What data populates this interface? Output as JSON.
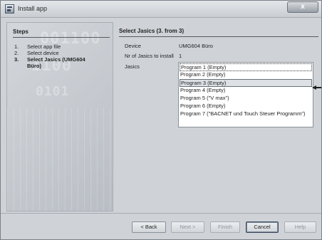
{
  "window": {
    "title": "Install app",
    "close_symbol": "x"
  },
  "steps": {
    "heading": "Steps",
    "items": [
      {
        "num": "1.",
        "label": "Select app file"
      },
      {
        "num": "2.",
        "label": "Select device"
      },
      {
        "num": "3.",
        "label": "Select Jasics (UMG604",
        "label2": "Büro)"
      }
    ]
  },
  "main": {
    "heading": "Select Jasics (3. from 3)",
    "fields": {
      "device_label": "Device",
      "device_value": "UMG604 Büro",
      "count_label": "Nr of Jasics to install",
      "count_value": "1",
      "jasics_label": "Jasics"
    },
    "jasics": [
      "Program 1 (Empty)",
      "Program 2 (Empty)",
      "Program 3 (Empty)",
      "Program 4 (Empty)",
      "Program 5 (\"V max\")",
      "Program 6 (Empty)",
      "Program 7 (\"BACNET und Touch Steuer Programm\")"
    ]
  },
  "buttons": {
    "back": "< Back",
    "next": "Next >",
    "finish": "Finish",
    "cancel": "Cancel",
    "help": "Help"
  },
  "watermark": {
    "line1": "001100",
    "line2": "1100",
    "line3": "0101"
  }
}
